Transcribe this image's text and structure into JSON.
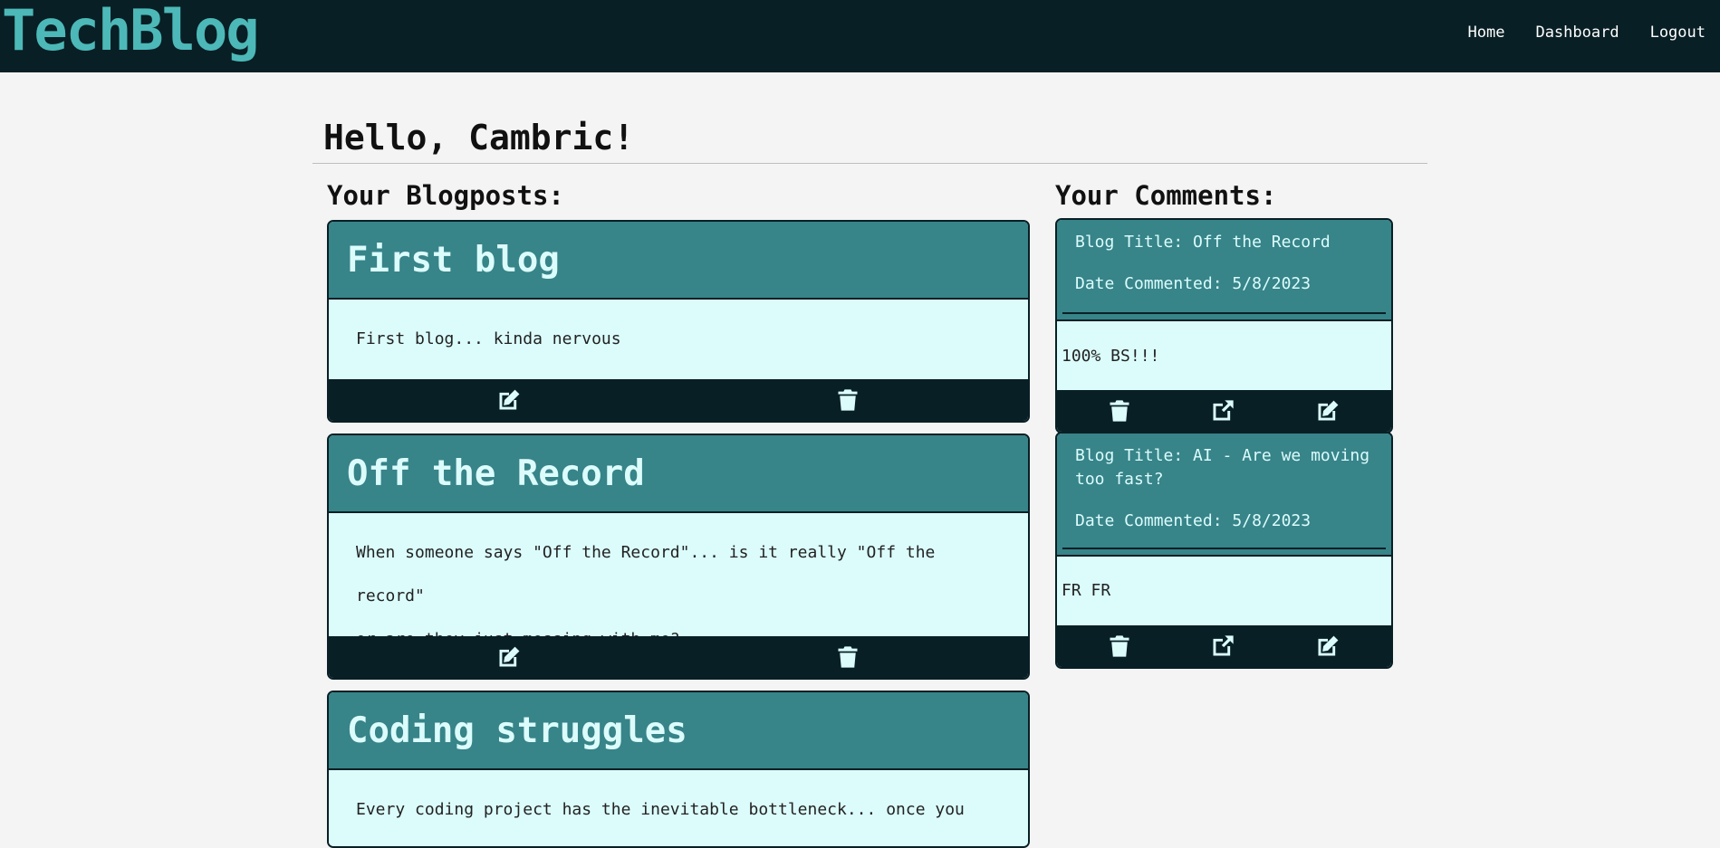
{
  "header": {
    "logo": "TechBlog",
    "nav": [
      {
        "label": "Home"
      },
      {
        "label": "Dashboard"
      },
      {
        "label": "Logout"
      }
    ]
  },
  "greeting": "Hello, Cambric!",
  "posts_section": {
    "title": "Your Blogposts:",
    "posts": [
      {
        "title": "First blog",
        "body_lines": [
          "First blog... kinda nervous"
        ],
        "edit_icon": "edit-icon",
        "delete_icon": "trash-icon"
      },
      {
        "title": "Off the Record",
        "body_lines": [
          "When someone says \"Off the Record\"... is it really \"Off the record\"",
          "or are they just messing with me?"
        ],
        "edit_icon": "edit-icon",
        "delete_icon": "trash-icon"
      },
      {
        "title": "Coding struggles",
        "body_lines": [
          "Every coding project has the inevitable bottleneck... once you get"
        ],
        "edit_icon": "edit-icon",
        "delete_icon": "trash-icon"
      }
    ]
  },
  "comments_section": {
    "title": "Your Comments:",
    "comments": [
      {
        "blog_title": "Blog Title: Off the Record",
        "date": "Date Commented: 5/8/2023",
        "text": "100% BS!!!",
        "icons": [
          "trash-icon",
          "external-link-icon",
          "edit-icon"
        ]
      },
      {
        "blog_title": "Blog Title: AI - Are we moving too fast?",
        "date": "Date Commented: 5/8/2023",
        "text": "FR FR",
        "icons": [
          "trash-icon",
          "external-link-icon",
          "edit-icon"
        ]
      }
    ]
  },
  "colors": {
    "navbar": "#081f25",
    "logo": "#4db8b8",
    "card_header": "#378489",
    "card_body": "#dcfcfc",
    "page_background": "#f4f4f4"
  }
}
